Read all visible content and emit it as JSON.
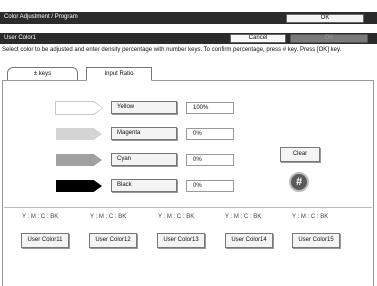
{
  "header": {
    "title": "Color Adjustment / Program",
    "ok_label": "OK",
    "subtitle": "User Color1",
    "cancel_label": "Cancel",
    "ok_disabled_label": "OK"
  },
  "instructions": "Select color to be adjusted and enter density percentage with number keys. To confirm percentage, press # key. Press [OK] key.",
  "tabs": [
    {
      "label": "± keys",
      "active": false
    },
    {
      "label": "Input Ratio",
      "active": true
    }
  ],
  "colors": [
    {
      "label": "Yellow",
      "value": "100%",
      "swatch": "#ffffff"
    },
    {
      "label": "Magenta",
      "value": "0%",
      "swatch": "#d4d4d4"
    },
    {
      "label": "Cyan",
      "value": "0%",
      "swatch": "#a0a0a0"
    },
    {
      "label": "Black",
      "value": "0%",
      "swatch": "#000000"
    }
  ],
  "actions": {
    "clear_label": "Clear",
    "hash_label": "#"
  },
  "user_colors": [
    {
      "ratio_label": "Y : M : C : BK",
      "button_label": "User Color11"
    },
    {
      "ratio_label": "Y : M : C : BK",
      "button_label": "User Color12"
    },
    {
      "ratio_label": "Y : M : C : BK",
      "button_label": "User Color13"
    },
    {
      "ratio_label": "Y : M : C : BK",
      "button_label": "User Color14"
    },
    {
      "ratio_label": "Y : M : C : BK",
      "button_label": "User Color15"
    }
  ]
}
